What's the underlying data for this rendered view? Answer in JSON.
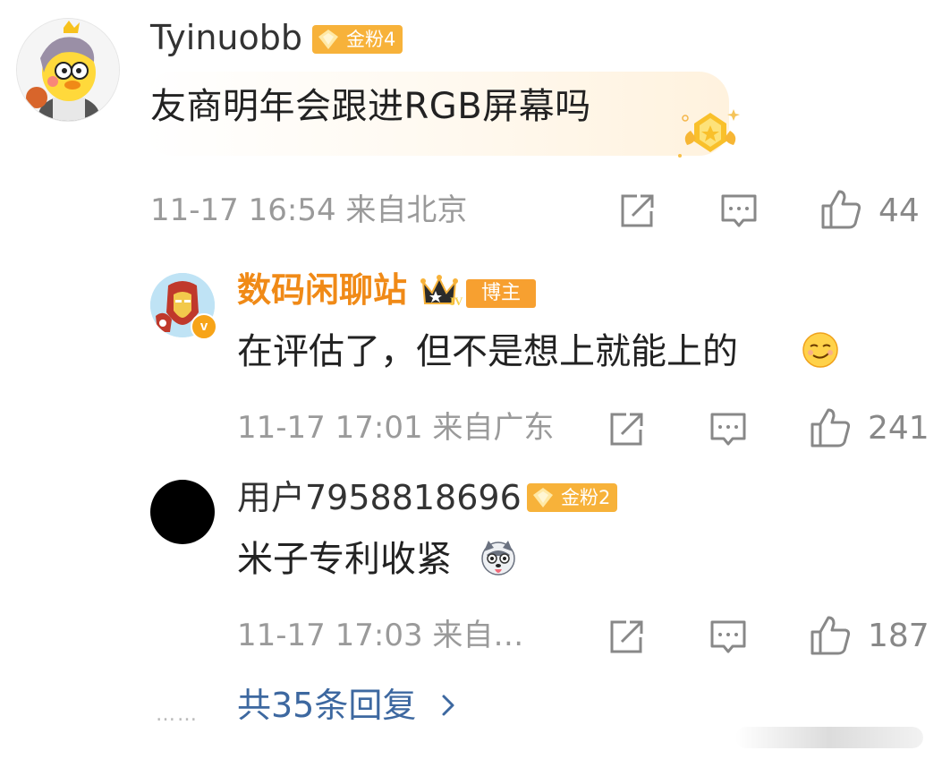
{
  "main_comment": {
    "username": "Tyinuobb",
    "fan_badge": "金粉4",
    "content": "友商明年会跟进RGB屏幕吗",
    "meta": "11-17 16:54  来自北京",
    "like_count": "44"
  },
  "replies": [
    {
      "username": "数码闲聊站",
      "role_badge": "博主",
      "level_badge": "IV",
      "verified_mark": "v",
      "content": "在评估了，但不是想上就能上的",
      "emoji": "smirk-emoji",
      "meta": "11-17 17:01  来自广东",
      "like_count": "241"
    },
    {
      "username": "用户7958818696",
      "fan_badge": "金粉2",
      "content": "米子专利收紧",
      "emoji": "husky-emoji",
      "meta": "11-17 17:03  来自…",
      "like_count": "187"
    }
  ],
  "more_replies": {
    "dots": "……",
    "label": "共35条回复"
  },
  "colors": {
    "accent_orange": "#f08a17",
    "badge_gold": "#f7b23a",
    "link_blue": "#3d68a0",
    "meta_gray": "#9a9a9a"
  }
}
